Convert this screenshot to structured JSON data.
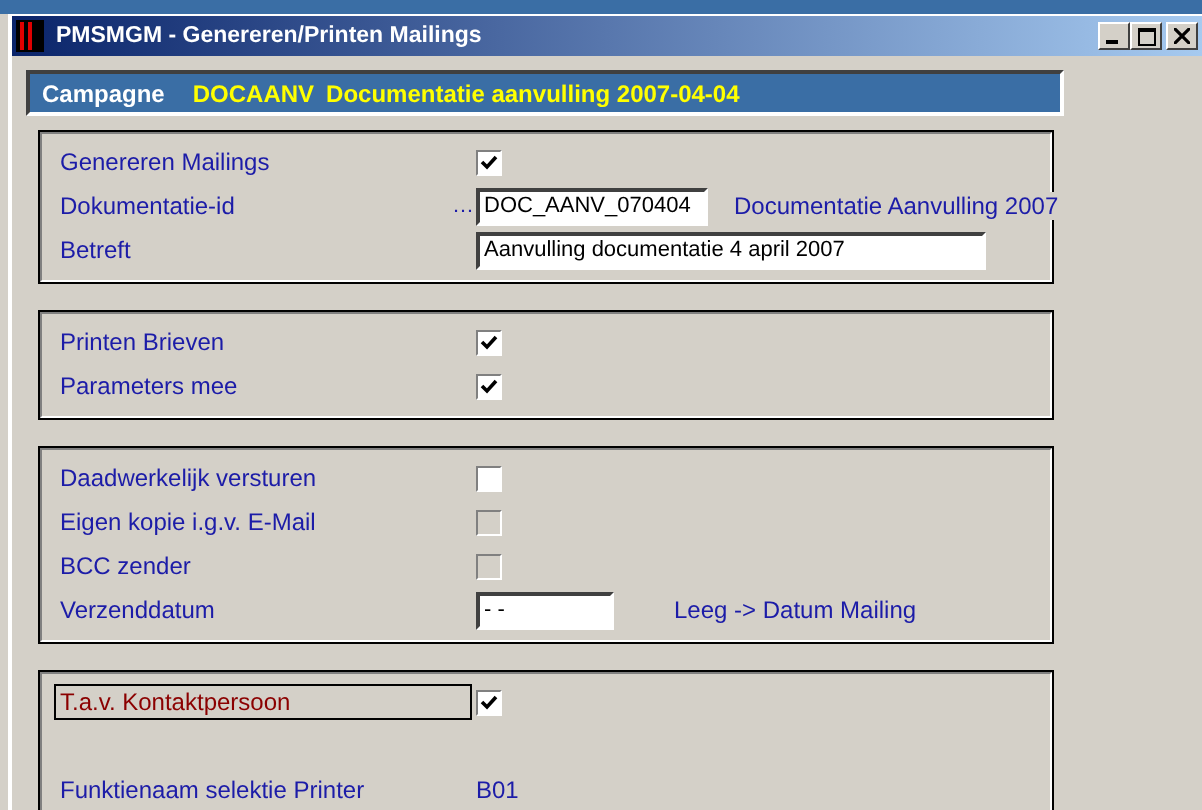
{
  "window": {
    "title": "PMSMGM - Genereren/Printen Mailings"
  },
  "campaign": {
    "label": "Campagne",
    "code": "DOCAANV",
    "description": "Documentatie aanvulling 2007-04-04"
  },
  "groups": [
    {
      "rows": [
        {
          "kind": "checkbox",
          "label": "Genereren Mailings",
          "checked": true,
          "disabled": false
        },
        {
          "kind": "id-input",
          "label": "Dokumentatie-id",
          "lookup_button": "…",
          "value": "DOC_AANV_070404",
          "note": "Documentatie Aanvulling 2007"
        },
        {
          "kind": "text-input",
          "label": "Betreft",
          "value": "Aanvulling documentatie 4 april 2007"
        }
      ]
    },
    {
      "rows": [
        {
          "kind": "checkbox",
          "label": "Printen Brieven",
          "checked": true,
          "disabled": false
        },
        {
          "kind": "checkbox",
          "label": "Parameters mee",
          "checked": true,
          "disabled": false
        }
      ]
    },
    {
      "rows": [
        {
          "kind": "checkbox",
          "label": "Daadwerkelijk versturen",
          "checked": false,
          "disabled": false
        },
        {
          "kind": "checkbox",
          "label": "Eigen kopie i.g.v. E-Mail",
          "checked": false,
          "disabled": true
        },
        {
          "kind": "checkbox",
          "label": "BCC zender",
          "checked": false,
          "disabled": true
        },
        {
          "kind": "date-input",
          "label": "Verzenddatum",
          "value": "- -",
          "note": "Leeg -> Datum Mailing"
        }
      ]
    },
    {
      "rows": [
        {
          "kind": "checkbox",
          "label": "T.a.v. Kontaktpersoon",
          "checked": true,
          "disabled": false,
          "focused": true
        },
        {
          "kind": "value",
          "label": "Funktienaam selektie Printer",
          "value": "B01"
        }
      ]
    }
  ]
}
